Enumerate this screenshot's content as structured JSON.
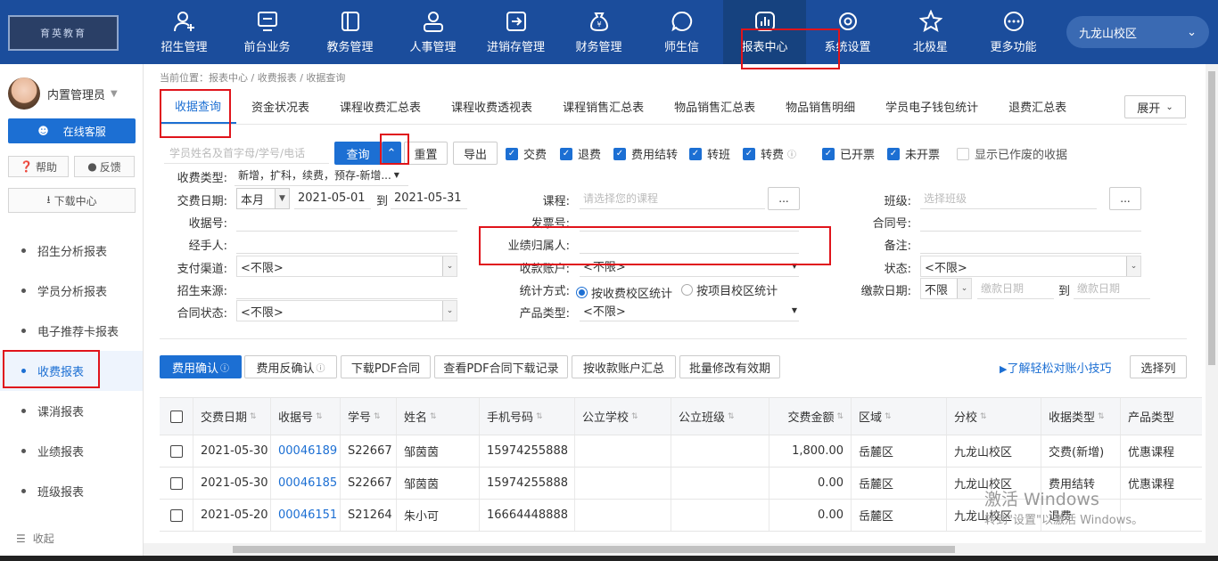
{
  "header": {
    "logo_text": "育英教育",
    "nav": [
      {
        "label": "招生管理",
        "icon": "add-user-icon"
      },
      {
        "label": "前台业务",
        "icon": "monitor-icon"
      },
      {
        "label": "教务管理",
        "icon": "book-icon"
      },
      {
        "label": "人事管理",
        "icon": "person-icon"
      },
      {
        "label": "进销存管理",
        "icon": "export-icon"
      },
      {
        "label": "财务管理",
        "icon": "money-bag-icon"
      },
      {
        "label": "师生信",
        "icon": "chat-icon"
      },
      {
        "label": "报表中心",
        "icon": "bar-chart-icon"
      },
      {
        "label": "系统设置",
        "icon": "gear-icon"
      },
      {
        "label": "北极星",
        "icon": "star-icon"
      },
      {
        "label": "更多功能",
        "icon": "more-icon"
      }
    ],
    "campus": "九龙山校区"
  },
  "sidebar": {
    "user_name": "内置管理员",
    "online_service": "在线客服",
    "help": "帮助",
    "feedback": "反馈",
    "download_center": "下载中心",
    "items": [
      "招生分析报表",
      "学员分析报表",
      "电子推荐卡报表",
      "收费报表",
      "课消报表",
      "业绩报表",
      "班级报表"
    ],
    "collapse": "收起"
  },
  "breadcrumb": "当前位置：报表中心 / 收费报表 / 收据查询",
  "tabs": [
    "收据查询",
    "资金状况表",
    "课程收费汇总表",
    "课程收费透视表",
    "课程销售汇总表",
    "物品销售汇总表",
    "物品销售明细",
    "学员电子钱包统计",
    "退费汇总表"
  ],
  "expand": "展开",
  "search": {
    "placeholder": "学员姓名及首字母/学号/电话",
    "query": "查询",
    "toggle": "⌃",
    "reset": "重置",
    "export": "导出"
  },
  "checks": [
    {
      "label": "交费",
      "on": true
    },
    {
      "label": "退费",
      "on": true
    },
    {
      "label": "费用结转",
      "on": true
    },
    {
      "label": "转班",
      "on": true
    },
    {
      "label": "转费",
      "on": true
    },
    {
      "label": "已开票",
      "on": true
    },
    {
      "label": "未开票",
      "on": true
    },
    {
      "label": "显示已作废的收据",
      "on": false
    }
  ],
  "filters": {
    "fee_type_label": "收费类型:",
    "fee_type_value": "新增，扩科，续费，预存-新增...",
    "date_label": "交费日期:",
    "date_range": "本月",
    "date_from": "2021-05-01",
    "to": "到",
    "date_to": "2021-05-31",
    "course_label": "课程:",
    "course_ph": "请选择您的课程",
    "class_label": "班级:",
    "class_ph": "选择班级",
    "more": "...",
    "receipt_label": "收据号:",
    "invoice_label": "发票号:",
    "contract_label": "合同号:",
    "handler_label": "经手人:",
    "owner_label": "业绩归属人:",
    "remark_label": "备注:",
    "pay_channel_label": "支付渠道:",
    "pay_channel": "<不限>",
    "account_label": "收款账户:",
    "account": "<不限>",
    "status_label": "状态:",
    "status": "<不限>",
    "source_label": "招生来源:",
    "stat_label": "统计方式:",
    "stat_opt1": "按收费校区统计",
    "stat_opt2": "按项目校区统计",
    "paydate_label": "缴款日期:",
    "paydate_range": "不限",
    "paydate_ph1": "缴款日期",
    "paydate_ph2": "缴款日期",
    "contract_status_label": "合同状态:",
    "contract_status": "<不限>",
    "product_label": "产品类型:",
    "product": "<不限>"
  },
  "actions": [
    "费用确认",
    "费用反确认",
    "下载PDF合同",
    "查看PDF合同下载记录",
    "按收款账户汇总",
    "批量修改有效期"
  ],
  "tip_link": "了解轻松对账小技巧",
  "select_columns": "选择列",
  "table": {
    "headers": [
      "交费日期",
      "收据号",
      "学号",
      "姓名",
      "手机号码",
      "公立学校",
      "公立班级",
      "交费金额",
      "区域",
      "分校",
      "收据类型",
      "产品类型"
    ],
    "rows": [
      [
        "2021-05-30",
        "00046189",
        "S22667",
        "邹茵茵",
        "15974255888",
        "",
        "",
        "1,800.00",
        "岳麓区",
        "九龙山校区",
        "交费(新增)",
        "优惠课程"
      ],
      [
        "2021-05-30",
        "00046185",
        "S22667",
        "邹茵茵",
        "15974255888",
        "",
        "",
        "0.00",
        "岳麓区",
        "九龙山校区",
        "费用结转",
        "优惠课程"
      ],
      [
        "2021-05-20",
        "00046151",
        "S21264",
        "朱小可",
        "16664448888",
        "",
        "",
        "0.00",
        "岳麓区",
        "九龙山校区",
        "退费",
        ""
      ]
    ]
  },
  "watermark": {
    "line1": "激活 Windows",
    "line2": "转到\"设置\"以激活 Windows。"
  },
  "colors": {
    "primary": "#1c6fd3",
    "header": "#1b4d9c",
    "highlight": "#e0141b"
  }
}
